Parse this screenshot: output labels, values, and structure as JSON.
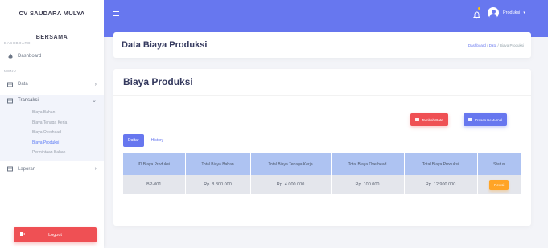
{
  "sidebar": {
    "brand": "CV SAUDARA MULYA",
    "brand_sub": "BERSAMA",
    "section_dashboard": "DASHBOARD",
    "section_menu": "MENU",
    "items": [
      {
        "label": "Dashboard",
        "icon": "fire-icon"
      },
      {
        "label": "Data",
        "icon": "table-icon"
      },
      {
        "label": "Transaksi",
        "icon": "table-icon"
      },
      {
        "label": "Laporan",
        "icon": "table-icon"
      }
    ],
    "transaksi_sub": [
      {
        "label": "Biaya Bahan"
      },
      {
        "label": "Biaya Tenaga Kerja"
      },
      {
        "label": "Biaya Overhead"
      },
      {
        "label": "Biaya Produksi"
      },
      {
        "label": "Permintaan Bahan"
      }
    ],
    "logout": "Logout"
  },
  "topbar": {
    "user": "Produksi"
  },
  "header": {
    "title": "Data Biaya Produksi",
    "breadcrumb": [
      "Dashboard",
      "Data",
      "Biaya Produksi"
    ]
  },
  "main": {
    "title": "Biaya Produksi",
    "add_button": "Tambah Data",
    "journal_button": "Proses Ke Jurnal",
    "tabs": [
      "Daftar",
      "History"
    ],
    "columns": [
      "ID Biaya Produksi",
      "Total Biaya Bahan",
      "Total Biaya Tenaga Kerja",
      "Total Biaya Overhead",
      "Total Biaya Produksi",
      "Status"
    ],
    "rows": [
      {
        "id": "BP-001",
        "bahan": "Rp. 8.800.000",
        "tenaga": "Rp. 4.000.000",
        "overhead": "Rp. 100.000",
        "produksi": "Rp. 12.900.000",
        "status": "Revisi"
      }
    ]
  },
  "colors": {
    "primary": "#6777ef",
    "danger": "#ef5054",
    "warning": "#ffa426",
    "table_header": "#aec3f2"
  }
}
